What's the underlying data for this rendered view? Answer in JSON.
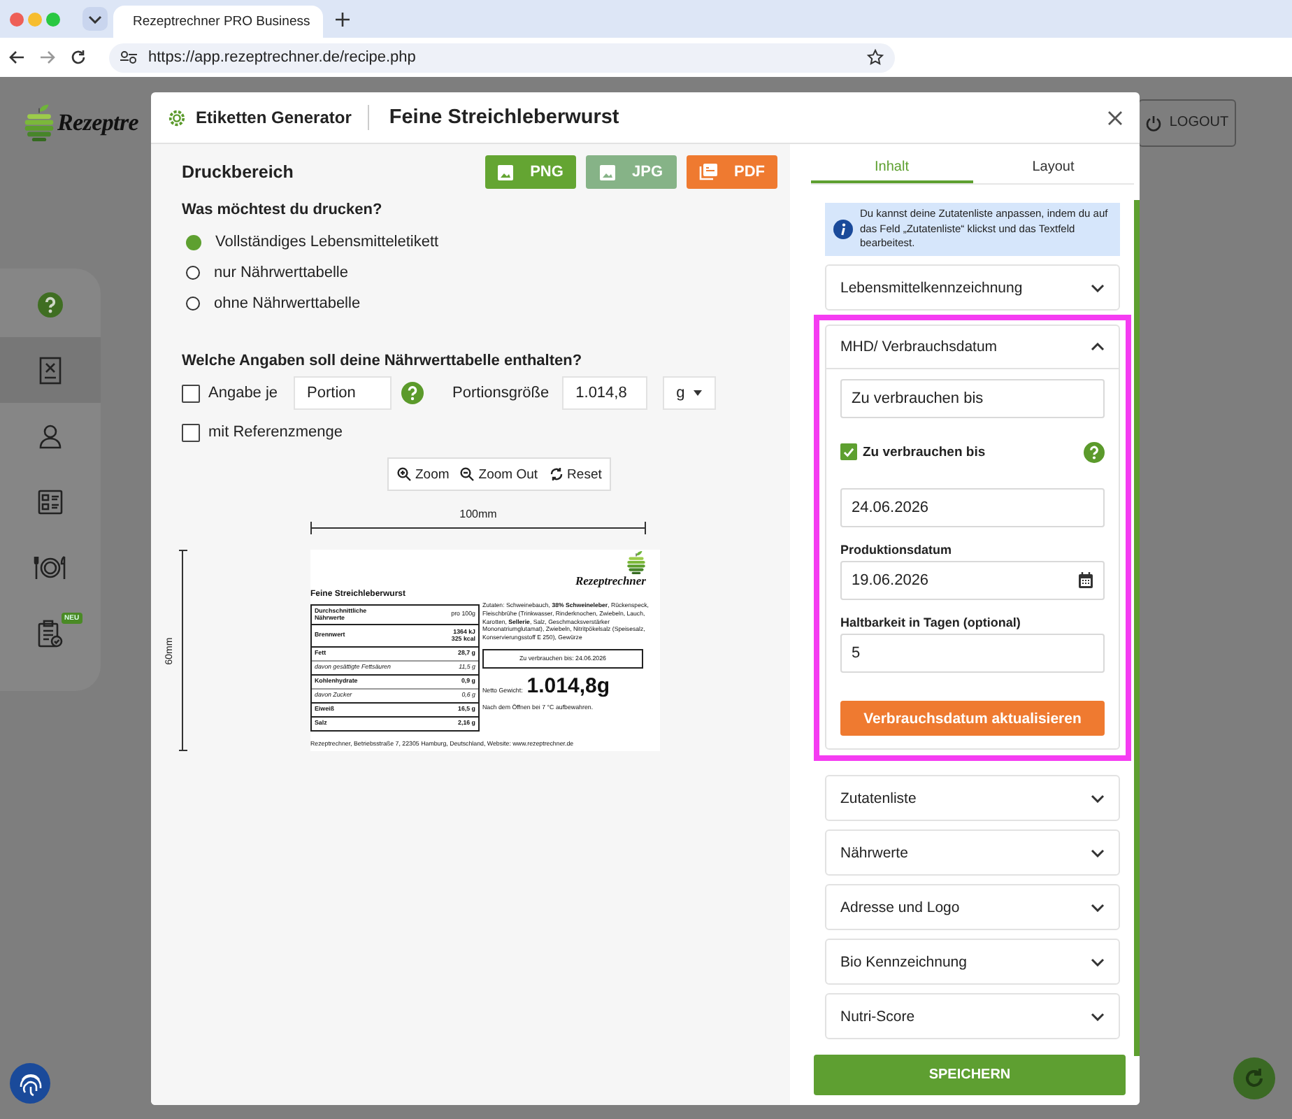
{
  "browser": {
    "tab_title": "Rezeptrechner PRO Business",
    "url": "https://app.rezeptrechner.de/recipe.php"
  },
  "app": {
    "logo_text": "Rezeptre",
    "logout_label": "LOGOUT",
    "sidebar": [
      {
        "kind": "help",
        "selected": false
      },
      {
        "kind": "recipe",
        "selected": true
      },
      {
        "kind": "user",
        "selected": false
      },
      {
        "kind": "checklist",
        "selected": false
      },
      {
        "kind": "dining",
        "selected": false
      },
      {
        "kind": "clipboard",
        "selected": false,
        "badge": "NEU"
      }
    ]
  },
  "modal": {
    "generator_label": "Etiketten Generator",
    "title": "Feine Streichleberwurst"
  },
  "print_area": {
    "title": "Druckbereich",
    "exports": [
      {
        "label": "PNG",
        "kind": "image",
        "color": "#64a532"
      },
      {
        "label": "JPG",
        "kind": "image",
        "color": "#86b387"
      },
      {
        "label": "PDF",
        "kind": "pdf",
        "color": "#ef7a30"
      }
    ],
    "print_question": "Was möchtest du drucken?",
    "print_options": [
      {
        "label": "Vollständiges Lebensmitteletikett",
        "selected": true
      },
      {
        "label": "nur Nährwerttabelle",
        "selected": false
      },
      {
        "label": "ohne Nährwerttabelle",
        "selected": false
      }
    ],
    "nutrition_question": "Welche Angaben soll deine Nährwerttabelle enthalten?",
    "per_checkbox": {
      "label": "Angabe je",
      "checked": false
    },
    "per_field": {
      "value": "Portion"
    },
    "portion_size_label": "Portionsgröße",
    "portion_size_field": {
      "value": "1.014,8"
    },
    "unit_select": {
      "value": "g"
    },
    "reference_checkbox": {
      "label": "mit Referenzmenge",
      "checked": false
    },
    "zoom_tools": [
      {
        "kind": "zoom-in",
        "label": "Zoom"
      },
      {
        "kind": "zoom-out",
        "label": "Zoom Out"
      },
      {
        "kind": "reset",
        "label": "Reset"
      }
    ],
    "ruler": {
      "width_label": "100mm",
      "height_label": "60mm"
    },
    "label": {
      "product_name": "Feine Streichleberwurst",
      "logo_text": "Rezeptrechner",
      "nutrition_rows": [
        {
          "kind": "header",
          "name": "Durchschnittliche Nährwerte",
          "values": [
            "pro 100g"
          ]
        },
        {
          "kind": "main",
          "name": "Brennwert",
          "values": [
            "1364 kJ",
            "325 kcal"
          ]
        },
        {
          "kind": "main",
          "name": "Fett",
          "values": [
            "28,7 g"
          ]
        },
        {
          "kind": "sub",
          "name": "davon gesättigte Fettsäuren",
          "values": [
            "11,5 g"
          ]
        },
        {
          "kind": "main",
          "name": "Kohlenhydrate",
          "values": [
            "0,9 g"
          ]
        },
        {
          "kind": "sub",
          "name": "davon Zucker",
          "values": [
            "0,6 g"
          ]
        },
        {
          "kind": "main",
          "name": "Eiweiß",
          "values": [
            "16,5 g"
          ]
        },
        {
          "kind": "main",
          "name": "Salz",
          "values": [
            "2,16 g"
          ]
        }
      ],
      "ingredients": "Zutaten: Schweinebauch, **38% Schweineleber**, Rückenspeck, Fleischbrühe (Trinkwasser, Rinderknochen, Zwiebeln, Lauch, Karotten, **Sellerie**, Salz, Geschmacksverstärker Mononatriumglutamat), Zwiebeln, Nitritpökelsalz (Speisesalz, Konservierungsstoff E 250), Gewürze",
      "use_by": "Zu verbrauchen bis: 24.06.2026",
      "net_weight_label": "Netto Gewicht:",
      "net_weight": "1.014,8g",
      "storage": "Nach dem Öffnen bei 7 °C aufbewahren.",
      "footer": "Rezeptrechner, Betriebsstraße 7, 22305 Hamburg, Deutschland, Website: www.rezeptrechner.de"
    }
  },
  "settings": {
    "tabs": [
      {
        "label": "Inhalt",
        "selected": true
      },
      {
        "label": "Layout",
        "selected": false
      }
    ],
    "info": "Du kannst deine Zutatenliste anpassen, indem du auf das Feld „Zutatenliste“ klickst und das Textfeld bearbeitest.",
    "sections": [
      {
        "title": "Lebensmittelkennzeichnung",
        "expanded": false,
        "highlighted": false
      },
      {
        "title": "MHD/ Verbrauchsdatum",
        "expanded": true,
        "highlighted": true,
        "content": {
          "label_field": {
            "value": "Zu verbrauchen bis"
          },
          "use_by_checkbox": {
            "label": "Zu verbrauchen bis",
            "checked": true
          },
          "date_field": {
            "value": "24.06.2026"
          },
          "production_label": "Produktionsdatum",
          "production_field": {
            "value": "19.06.2026"
          },
          "shelf_life_label": "Haltbarkeit in Tagen (optional)",
          "shelf_life_field": {
            "value": "5"
          },
          "update_button": "Verbrauchsdatum aktualisieren"
        }
      },
      {
        "title": "Zutatenliste",
        "expanded": false,
        "highlighted": false
      },
      {
        "title": "Nährwerte",
        "expanded": false,
        "highlighted": false
      },
      {
        "title": "Adresse und Logo",
        "expanded": false,
        "highlighted": false
      },
      {
        "title": "Bio Kennzeichnung",
        "expanded": false,
        "highlighted": false
      },
      {
        "title": "Nutri-Score",
        "expanded": false,
        "highlighted": false
      }
    ],
    "save_button": "SPEICHERN"
  }
}
